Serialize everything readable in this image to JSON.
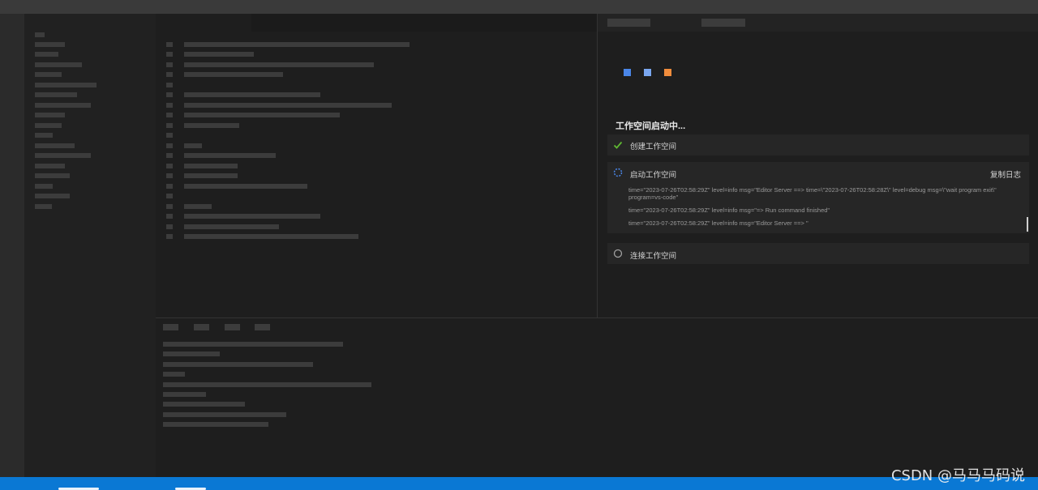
{
  "colors": {
    "logo_square_1": "#4a86e8",
    "logo_square_2": "#7aa7f0",
    "logo_square_3": "#f08c3c",
    "check": "#5fb832",
    "spinner": "#4a86e8",
    "status_bar": "#0a78d4"
  },
  "workspace": {
    "title": "工作空间启动中...",
    "steps": [
      {
        "label": "创建工作空间",
        "status": "done",
        "icon": "check-icon"
      },
      {
        "label": "启动工作空间",
        "status": "in-progress",
        "icon": "spinner-icon",
        "action": "复制日志"
      },
      {
        "label": "连接工作空间",
        "status": "pending",
        "icon": "circle-icon"
      }
    ],
    "logs": [
      "time=\"2023-07-26T02:58:29Z\" level=info msg=\"Editor Server ==> time=\\\"2023-07-26T02:58:28Z\\\" level=debug msg=\\\"wait program exit\\\" program=vs-code\"",
      "time=\"2023-07-26T02:58:29Z\" level=info msg=\"=> Run command finished\"",
      "time=\"2023-07-26T02:58:29Z\" level=info msg=\"Editor Server ==> \""
    ]
  },
  "watermark": "CSDN @马马马码说"
}
